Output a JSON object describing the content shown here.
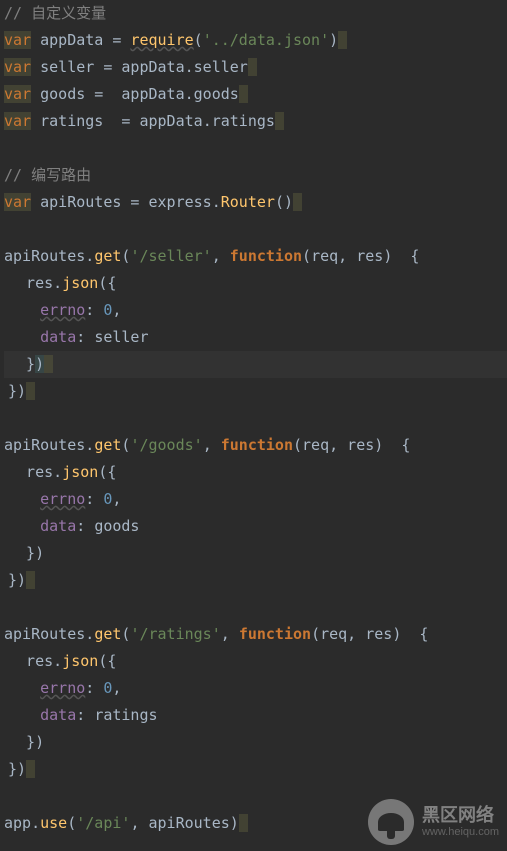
{
  "code": {
    "comment1": "// 自定义变量",
    "l2": {
      "var": "var",
      "name": "appData",
      "eq": " = ",
      "call": "require",
      "lp": "(",
      "str": "'../data.json'",
      "rp": ")"
    },
    "l3": {
      "var": "var",
      "name": "seller",
      "eq": " = ",
      "obj": "appData",
      "dot": ".",
      "prop": "seller"
    },
    "l4": {
      "var": "var",
      "name": "goods",
      "eq": " =  ",
      "obj": "appData",
      "dot": ".",
      "prop": "goods"
    },
    "l5": {
      "var": "var",
      "name": "ratings",
      "eq": "  = ",
      "obj": "appData",
      "dot": ".",
      "prop": "ratings"
    },
    "comment2": "// 编写路由",
    "l7": {
      "var": "var",
      "name": "apiRoutes",
      "eq": " = ",
      "obj": "express",
      "dot": ".",
      "call": "Router",
      "lp": "(",
      "rp": ")"
    },
    "route1": {
      "recv": "apiRoutes",
      "dot": ".",
      "method": "get",
      "lp": "(",
      "path": "'/seller'",
      "comma": ", ",
      "fn": "function",
      "lp2": "(",
      "args": "req, res",
      "rp2": ")",
      "ob": "  {",
      "resline": "  res.",
      "json": "json",
      "lp3": "(",
      "ob2": "{",
      "errno_k": "errno",
      "colon": ": ",
      "errno_v": "0",
      "c2": ",",
      "data_k": "data",
      "colon2": ": ",
      "data_v": "seller",
      "cb2": "  }",
      "rp3": ")",
      "cb": "}",
      "rp4": ")"
    },
    "route2": {
      "recv": "apiRoutes",
      "dot": ".",
      "method": "get",
      "lp": "(",
      "path": "'/goods'",
      "comma": ", ",
      "fn": "function",
      "lp2": "(",
      "args": "req, res",
      "rp2": ")",
      "ob": "  {",
      "resline": "  res.",
      "json": "json",
      "lp3": "(",
      "ob2": "{",
      "errno_k": "errno",
      "colon": ": ",
      "errno_v": "0",
      "c2": ",",
      "data_k": "data",
      "colon2": ": ",
      "data_v": "goods",
      "cb2": "  }",
      "rp3": ")",
      "cb": "}",
      "rp4": ")"
    },
    "route3": {
      "recv": "apiRoutes",
      "dot": ".",
      "method": "get",
      "lp": "(",
      "path": "'/ratings'",
      "comma": ", ",
      "fn": "function",
      "lp2": "(",
      "args": "req, res",
      "rp2": ")",
      "ob": "  {",
      "resline": "  res.",
      "json": "json",
      "lp3": "(",
      "ob2": "{",
      "errno_k": "errno",
      "colon": ": ",
      "errno_v": "0",
      "c2": ",",
      "data_k": "data",
      "colon2": ": ",
      "data_v": "ratings",
      "cb2": "  }",
      "rp3": ")",
      "cb": "}",
      "rp4": ")"
    },
    "use": {
      "recv": "app",
      "dot": ".",
      "method": "use",
      "lp": "(",
      "path": "'/api'",
      "comma": ", ",
      "arg": "apiRoutes",
      "rp": ")"
    }
  },
  "watermark": {
    "title": "黑区网络",
    "url": "www.heiqu.com"
  }
}
